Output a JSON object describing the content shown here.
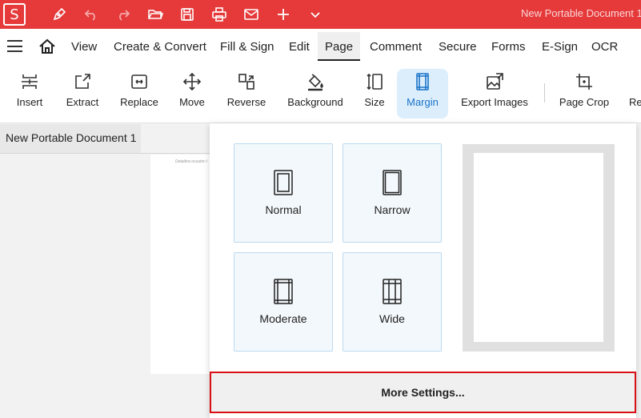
{
  "app": {
    "logo_letter": "S",
    "document_title": "New Portable Document 1"
  },
  "quick_access": [
    "pen-icon",
    "undo-icon",
    "redo-icon",
    "open-folder-icon",
    "save-icon",
    "print-icon",
    "mail-icon",
    "add-icon",
    "chevron-down-icon"
  ],
  "menu": {
    "items": [
      "View",
      "Create & Convert",
      "Fill & Sign",
      "Edit",
      "Page",
      "Comment",
      "Secure",
      "Forms",
      "E-Sign",
      "OCR"
    ],
    "active": "Page"
  },
  "ribbon": {
    "tools": [
      "Insert",
      "Extract",
      "Replace",
      "Move",
      "Reverse",
      "Background",
      "Size",
      "Margin",
      "Export Images",
      "Page Crop",
      "Re"
    ],
    "active": "Margin"
  },
  "tabs": {
    "document": "New Portable Document 1"
  },
  "page": {
    "faint_text": "Detaibra ocuutre t"
  },
  "margin_panel": {
    "options": [
      "Normal",
      "Narrow",
      "Moderate",
      "Wide"
    ],
    "more_settings": "More Settings..."
  },
  "colors": {
    "titlebar": "#e5393a",
    "accent": "#1a73c8",
    "highlight_border": "#d90f16"
  }
}
